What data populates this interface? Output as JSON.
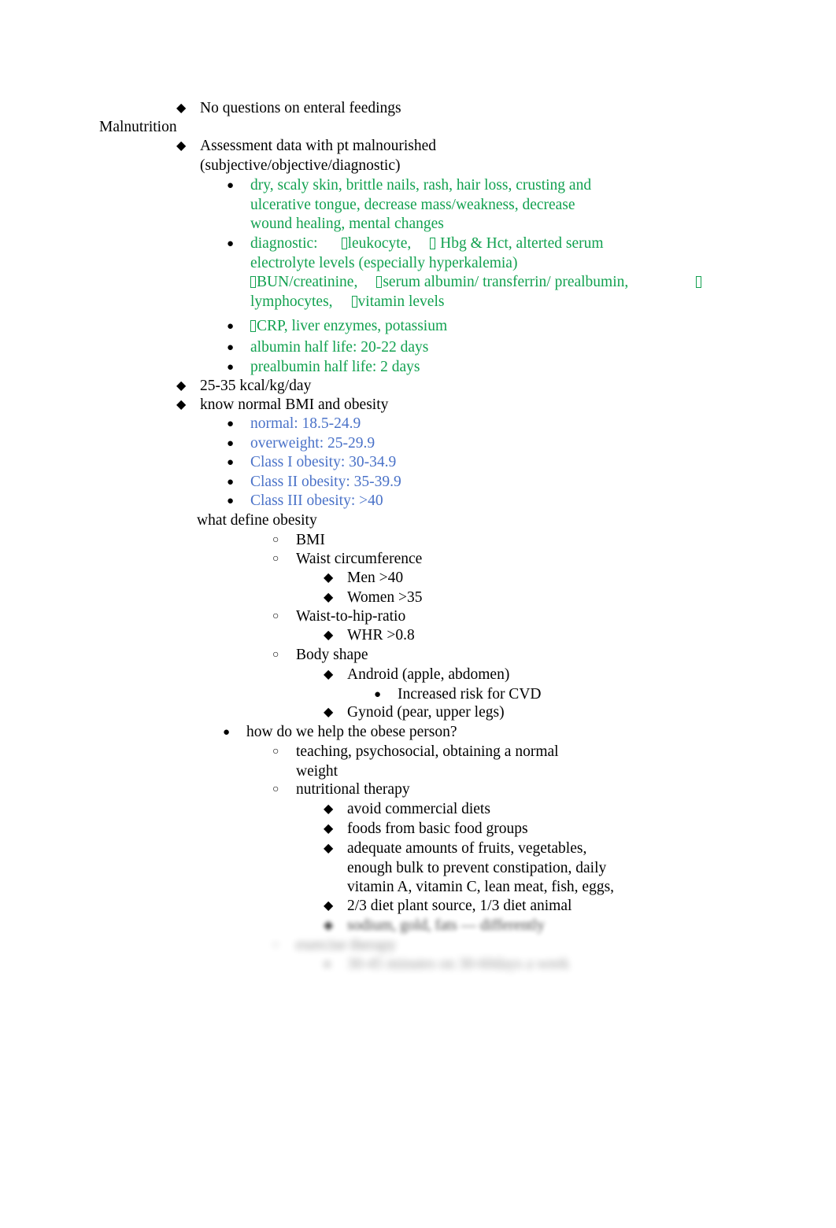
{
  "document": {
    "title_text": "Malnutrition",
    "colors": {
      "text": "#000000",
      "green": "#12a150",
      "blue": "#4a72c8",
      "background": "#ffffff"
    },
    "bullets": {
      "diamond": "◆",
      "filled_circle": "●",
      "hollow_circle": "○"
    },
    "lines": {
      "no_questions": "No questions on enteral feedings",
      "malnutrition_heading": "Malnutrition",
      "assessment_l1": "Assessment data with pt malnourished",
      "assessment_l2": "(subjective/objective/diagnostic)",
      "signs_l1": "dry, scaly skin, brittle nails, rash, hair loss, crusting and",
      "signs_l2": "ulcerative tongue, decrease mass/weakness, decrease",
      "signs_l3": "wound healing, mental changes",
      "diagnostic_label": "diagnostic:",
      "diagnostic_leukocyte": "leukocyte,",
      "diagnostic_hbg_hct": "Hbg & Hct, alterted serum",
      "diagnostic_electrolytes": "electrolyte levels (especially hyperkalemia)",
      "diagnostic_bun": "BUN/creatinine,",
      "diagnostic_albumin": "serum albumin/ transferrin/ prealbumin,",
      "diagnostic_lymphocytes": "lymphocytes,",
      "diagnostic_vitamin": "vitamin levels",
      "crp_line": "CRP, liver enzymes, potassium",
      "albumin_half_life": "albumin half life: 20-22 days",
      "prealbumin_half_life": "prealbumin half life: 2 days",
      "kcal": "25-35 kcal/kg/day",
      "know_bmi": "know normal BMI and obesity",
      "bmi_normal": "normal: 18.5-24.9",
      "bmi_overweight": "overweight: 25-29.9",
      "bmi_class1": "Class I obesity: 30-34.9",
      "bmi_class2": "Class II obesity: 35-39.9",
      "bmi_class3": "Class III obesity: >40",
      "what_define_obesity": "what define obesity",
      "bmi": "BMI",
      "waist_circumference": "Waist circumference",
      "men": "Men >40",
      "women": "Women >35",
      "waist_to_hip": "Waist-to-hip-ratio",
      "whr": "WHR >0.8",
      "body_shape": "Body shape",
      "android": "Android (apple, abdomen)",
      "increased_cvd": "Increased risk for CVD",
      "gynoid": "Gynoid (pear, upper legs)",
      "how_help": "how do we help the obese person?",
      "teaching_l1": "teaching, psychosocial, obtaining a normal",
      "teaching_l2": "weight",
      "nutritional_therapy": "nutritional therapy",
      "avoid_diets": "avoid commercial diets",
      "basic_food_groups": "foods from basic food groups",
      "adequate_l1": "adequate amounts of fruits, vegetables,",
      "adequate_l2": "enough bulk to prevent constipation, daily",
      "adequate_l3": "vitamin A, vitamin C, lean meat, fish, eggs,",
      "diet_ratio": "2/3 diet plant source, 1/3 diet animal",
      "faded_1": "sodium, gold, fats — differently",
      "faded_2": "exercise therapy",
      "faded_3": "30-45 minutes on 30-60days a week"
    }
  }
}
